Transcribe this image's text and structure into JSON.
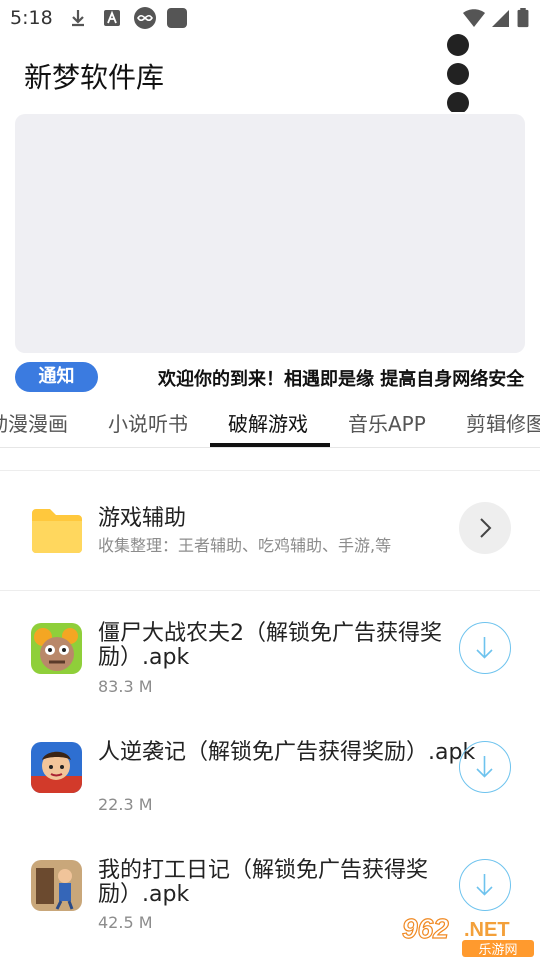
{
  "status_bar": {
    "time": "5:18",
    "left_icons": [
      "download-icon",
      "font-icon",
      "infinity-icon",
      "app-square-icon"
    ],
    "right_icons": [
      "wifi-icon",
      "signal-icon",
      "battery-icon"
    ]
  },
  "header": {
    "title": "新梦软件库",
    "menu_icon": "more-vertical-icon"
  },
  "notice": {
    "badge": "通知",
    "text": "欢迎你的到来！相遇即是缘 提高自身网络安全"
  },
  "tabs": [
    {
      "label": "动漫漫画",
      "active": false
    },
    {
      "label": "小说听书",
      "active": false
    },
    {
      "label": "破解游戏",
      "active": true
    },
    {
      "label": "音乐APP",
      "active": false
    },
    {
      "label": "剪辑修图",
      "active": false
    }
  ],
  "folder": {
    "title": "游戏辅助",
    "subtitle": "收集整理：王者辅助、吃鸡辅助、手游,等",
    "icon": "folder-icon",
    "action_icon": "chevron-right-icon"
  },
  "apps": [
    {
      "name": "僵尸大战农夫2（解锁免广告获得奖励）.apk",
      "size": "83.3 M",
      "icon": "zombie-game-icon"
    },
    {
      "name": "人逆袭记（解锁免广告获得奖励）.apk",
      "size": "22.3 M",
      "icon": "comeback-game-icon"
    },
    {
      "name": "我的打工日记（解锁免广告获得奖励）.apk",
      "size": "42.5 M",
      "icon": "worker-game-icon"
    }
  ],
  "watermark": {
    "brand": "962",
    "suffix": ".NET",
    "caption": "乐游网"
  },
  "colors": {
    "accent": "#3b7be0",
    "download_ring": "#6ec3ee",
    "banner_bg": "#efeff3",
    "tab_indicator": "#111111",
    "folder": "#ffcb47"
  }
}
